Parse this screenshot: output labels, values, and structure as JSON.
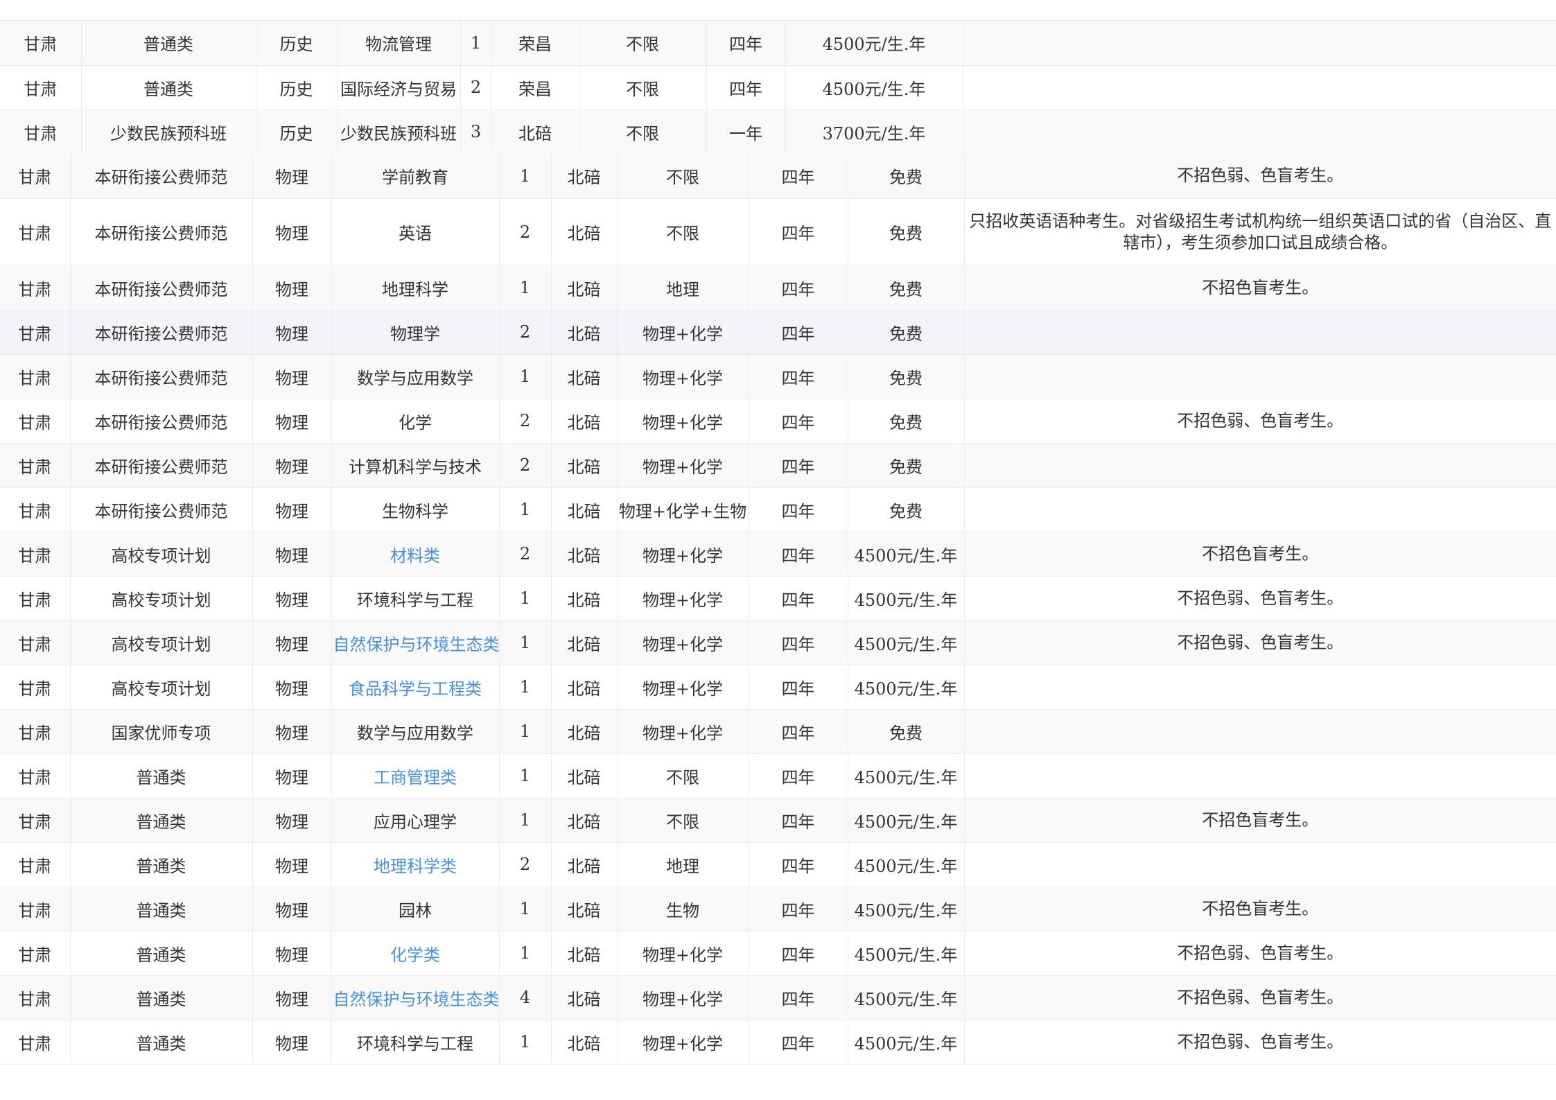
{
  "top_rows": [
    {
      "province": "甘肃",
      "type": "普通类",
      "subject": "历史",
      "major": "物流管理",
      "count": "1",
      "campus": "荣昌",
      "require": "不限",
      "years": "四年",
      "fee": "4500元/生.年",
      "note": "",
      "link": false
    },
    {
      "province": "甘肃",
      "type": "普通类",
      "subject": "历史",
      "major": "国际经济与贸易",
      "count": "2",
      "campus": "荣昌",
      "require": "不限",
      "years": "四年",
      "fee": "4500元/生.年",
      "note": "",
      "link": false
    },
    {
      "province": "甘肃",
      "type": "少数民族预科班",
      "subject": "历史",
      "major": "少数民族预科班",
      "count": "3",
      "campus": "北碚",
      "require": "不限",
      "years": "一年",
      "fee": "3700元/生.年",
      "note": "",
      "link": false
    }
  ],
  "main_rows": [
    {
      "province": "甘肃",
      "type": "本研衔接公费师范",
      "subject": "物理",
      "major": "学前教育",
      "count": "1",
      "campus": "北碚",
      "require": "不限",
      "years": "四年",
      "fee": "免费",
      "note": "不招色弱、色盲考生。",
      "link": false
    },
    {
      "province": "甘肃",
      "type": "本研衔接公费师范",
      "subject": "物理",
      "major": "英语",
      "count": "2",
      "campus": "北碚",
      "require": "不限",
      "years": "四年",
      "fee": "免费",
      "note": "只招收英语语种考生。对省级招生考试机构统一组织英语口试的省（自治区、直辖市），考生须参加口试且成绩合格。",
      "link": false
    },
    {
      "province": "甘肃",
      "type": "本研衔接公费师范",
      "subject": "物理",
      "major": "地理科学",
      "count": "1",
      "campus": "北碚",
      "require": "地理",
      "years": "四年",
      "fee": "免费",
      "note": "不招色盲考生。",
      "link": false
    },
    {
      "province": "甘肃",
      "type": "本研衔接公费师范",
      "subject": "物理",
      "major": "物理学",
      "count": "2",
      "campus": "北碚",
      "require": "物理+化学",
      "years": "四年",
      "fee": "免费",
      "note": "",
      "link": false
    },
    {
      "province": "甘肃",
      "type": "本研衔接公费师范",
      "subject": "物理",
      "major": "数学与应用数学",
      "count": "1",
      "campus": "北碚",
      "require": "物理+化学",
      "years": "四年",
      "fee": "免费",
      "note": "",
      "link": false
    },
    {
      "province": "甘肃",
      "type": "本研衔接公费师范",
      "subject": "物理",
      "major": "化学",
      "count": "2",
      "campus": "北碚",
      "require": "物理+化学",
      "years": "四年",
      "fee": "免费",
      "note": "不招色弱、色盲考生。",
      "link": false
    },
    {
      "province": "甘肃",
      "type": "本研衔接公费师范",
      "subject": "物理",
      "major": "计算机科学与技术",
      "count": "2",
      "campus": "北碚",
      "require": "物理+化学",
      "years": "四年",
      "fee": "免费",
      "note": "",
      "link": false
    },
    {
      "province": "甘肃",
      "type": "本研衔接公费师范",
      "subject": "物理",
      "major": "生物科学",
      "count": "1",
      "campus": "北碚",
      "require": "物理+化学+生物",
      "years": "四年",
      "fee": "免费",
      "note": "",
      "link": false
    },
    {
      "province": "甘肃",
      "type": "高校专项计划",
      "subject": "物理",
      "major": "材料类",
      "count": "2",
      "campus": "北碚",
      "require": "物理+化学",
      "years": "四年",
      "fee": "4500元/生.年",
      "note": "不招色盲考生。",
      "link": true
    },
    {
      "province": "甘肃",
      "type": "高校专项计划",
      "subject": "物理",
      "major": "环境科学与工程",
      "count": "1",
      "campus": "北碚",
      "require": "物理+化学",
      "years": "四年",
      "fee": "4500元/生.年",
      "note": "不招色弱、色盲考生。",
      "link": false
    },
    {
      "province": "甘肃",
      "type": "高校专项计划",
      "subject": "物理",
      "major": "自然保护与环境生态类",
      "count": "1",
      "campus": "北碚",
      "require": "物理+化学",
      "years": "四年",
      "fee": "4500元/生.年",
      "note": "不招色弱、色盲考生。",
      "link": true
    },
    {
      "province": "甘肃",
      "type": "高校专项计划",
      "subject": "物理",
      "major": "食品科学与工程类",
      "count": "1",
      "campus": "北碚",
      "require": "物理+化学",
      "years": "四年",
      "fee": "4500元/生.年",
      "note": "",
      "link": true
    },
    {
      "province": "甘肃",
      "type": "国家优师专项",
      "subject": "物理",
      "major": "数学与应用数学",
      "count": "1",
      "campus": "北碚",
      "require": "物理+化学",
      "years": "四年",
      "fee": "免费",
      "note": "",
      "link": false
    },
    {
      "province": "甘肃",
      "type": "普通类",
      "subject": "物理",
      "major": "工商管理类",
      "count": "1",
      "campus": "北碚",
      "require": "不限",
      "years": "四年",
      "fee": "4500元/生.年",
      "note": "",
      "link": true
    },
    {
      "province": "甘肃",
      "type": "普通类",
      "subject": "物理",
      "major": "应用心理学",
      "count": "1",
      "campus": "北碚",
      "require": "不限",
      "years": "四年",
      "fee": "4500元/生.年",
      "note": "不招色盲考生。",
      "link": false
    },
    {
      "province": "甘肃",
      "type": "普通类",
      "subject": "物理",
      "major": "地理科学类",
      "count": "2",
      "campus": "北碚",
      "require": "地理",
      "years": "四年",
      "fee": "4500元/生.年",
      "note": "",
      "link": true
    },
    {
      "province": "甘肃",
      "type": "普通类",
      "subject": "物理",
      "major": "园林",
      "count": "1",
      "campus": "北碚",
      "require": "生物",
      "years": "四年",
      "fee": "4500元/生.年",
      "note": "不招色盲考生。",
      "link": false
    },
    {
      "province": "甘肃",
      "type": "普通类",
      "subject": "物理",
      "major": "化学类",
      "count": "1",
      "campus": "北碚",
      "require": "物理+化学",
      "years": "四年",
      "fee": "4500元/生.年",
      "note": "不招色弱、色盲考生。",
      "link": true
    },
    {
      "province": "甘肃",
      "type": "普通类",
      "subject": "物理",
      "major": "自然保护与环境生态类",
      "count": "4",
      "campus": "北碚",
      "require": "物理+化学",
      "years": "四年",
      "fee": "4500元/生.年",
      "note": "不招色弱、色盲考生。",
      "link": true
    },
    {
      "province": "甘肃",
      "type": "普通类",
      "subject": "物理",
      "major": "环境科学与工程",
      "count": "1",
      "campus": "北碚",
      "require": "物理+化学",
      "years": "四年",
      "fee": "4500元/生.年",
      "note": "不招色弱、色盲考生。",
      "link": false
    }
  ],
  "colors": {
    "link": "#4a90d9",
    "border": "#ececec",
    "stripe": "#f9f9f9",
    "highlight": "#f2f4f8"
  }
}
